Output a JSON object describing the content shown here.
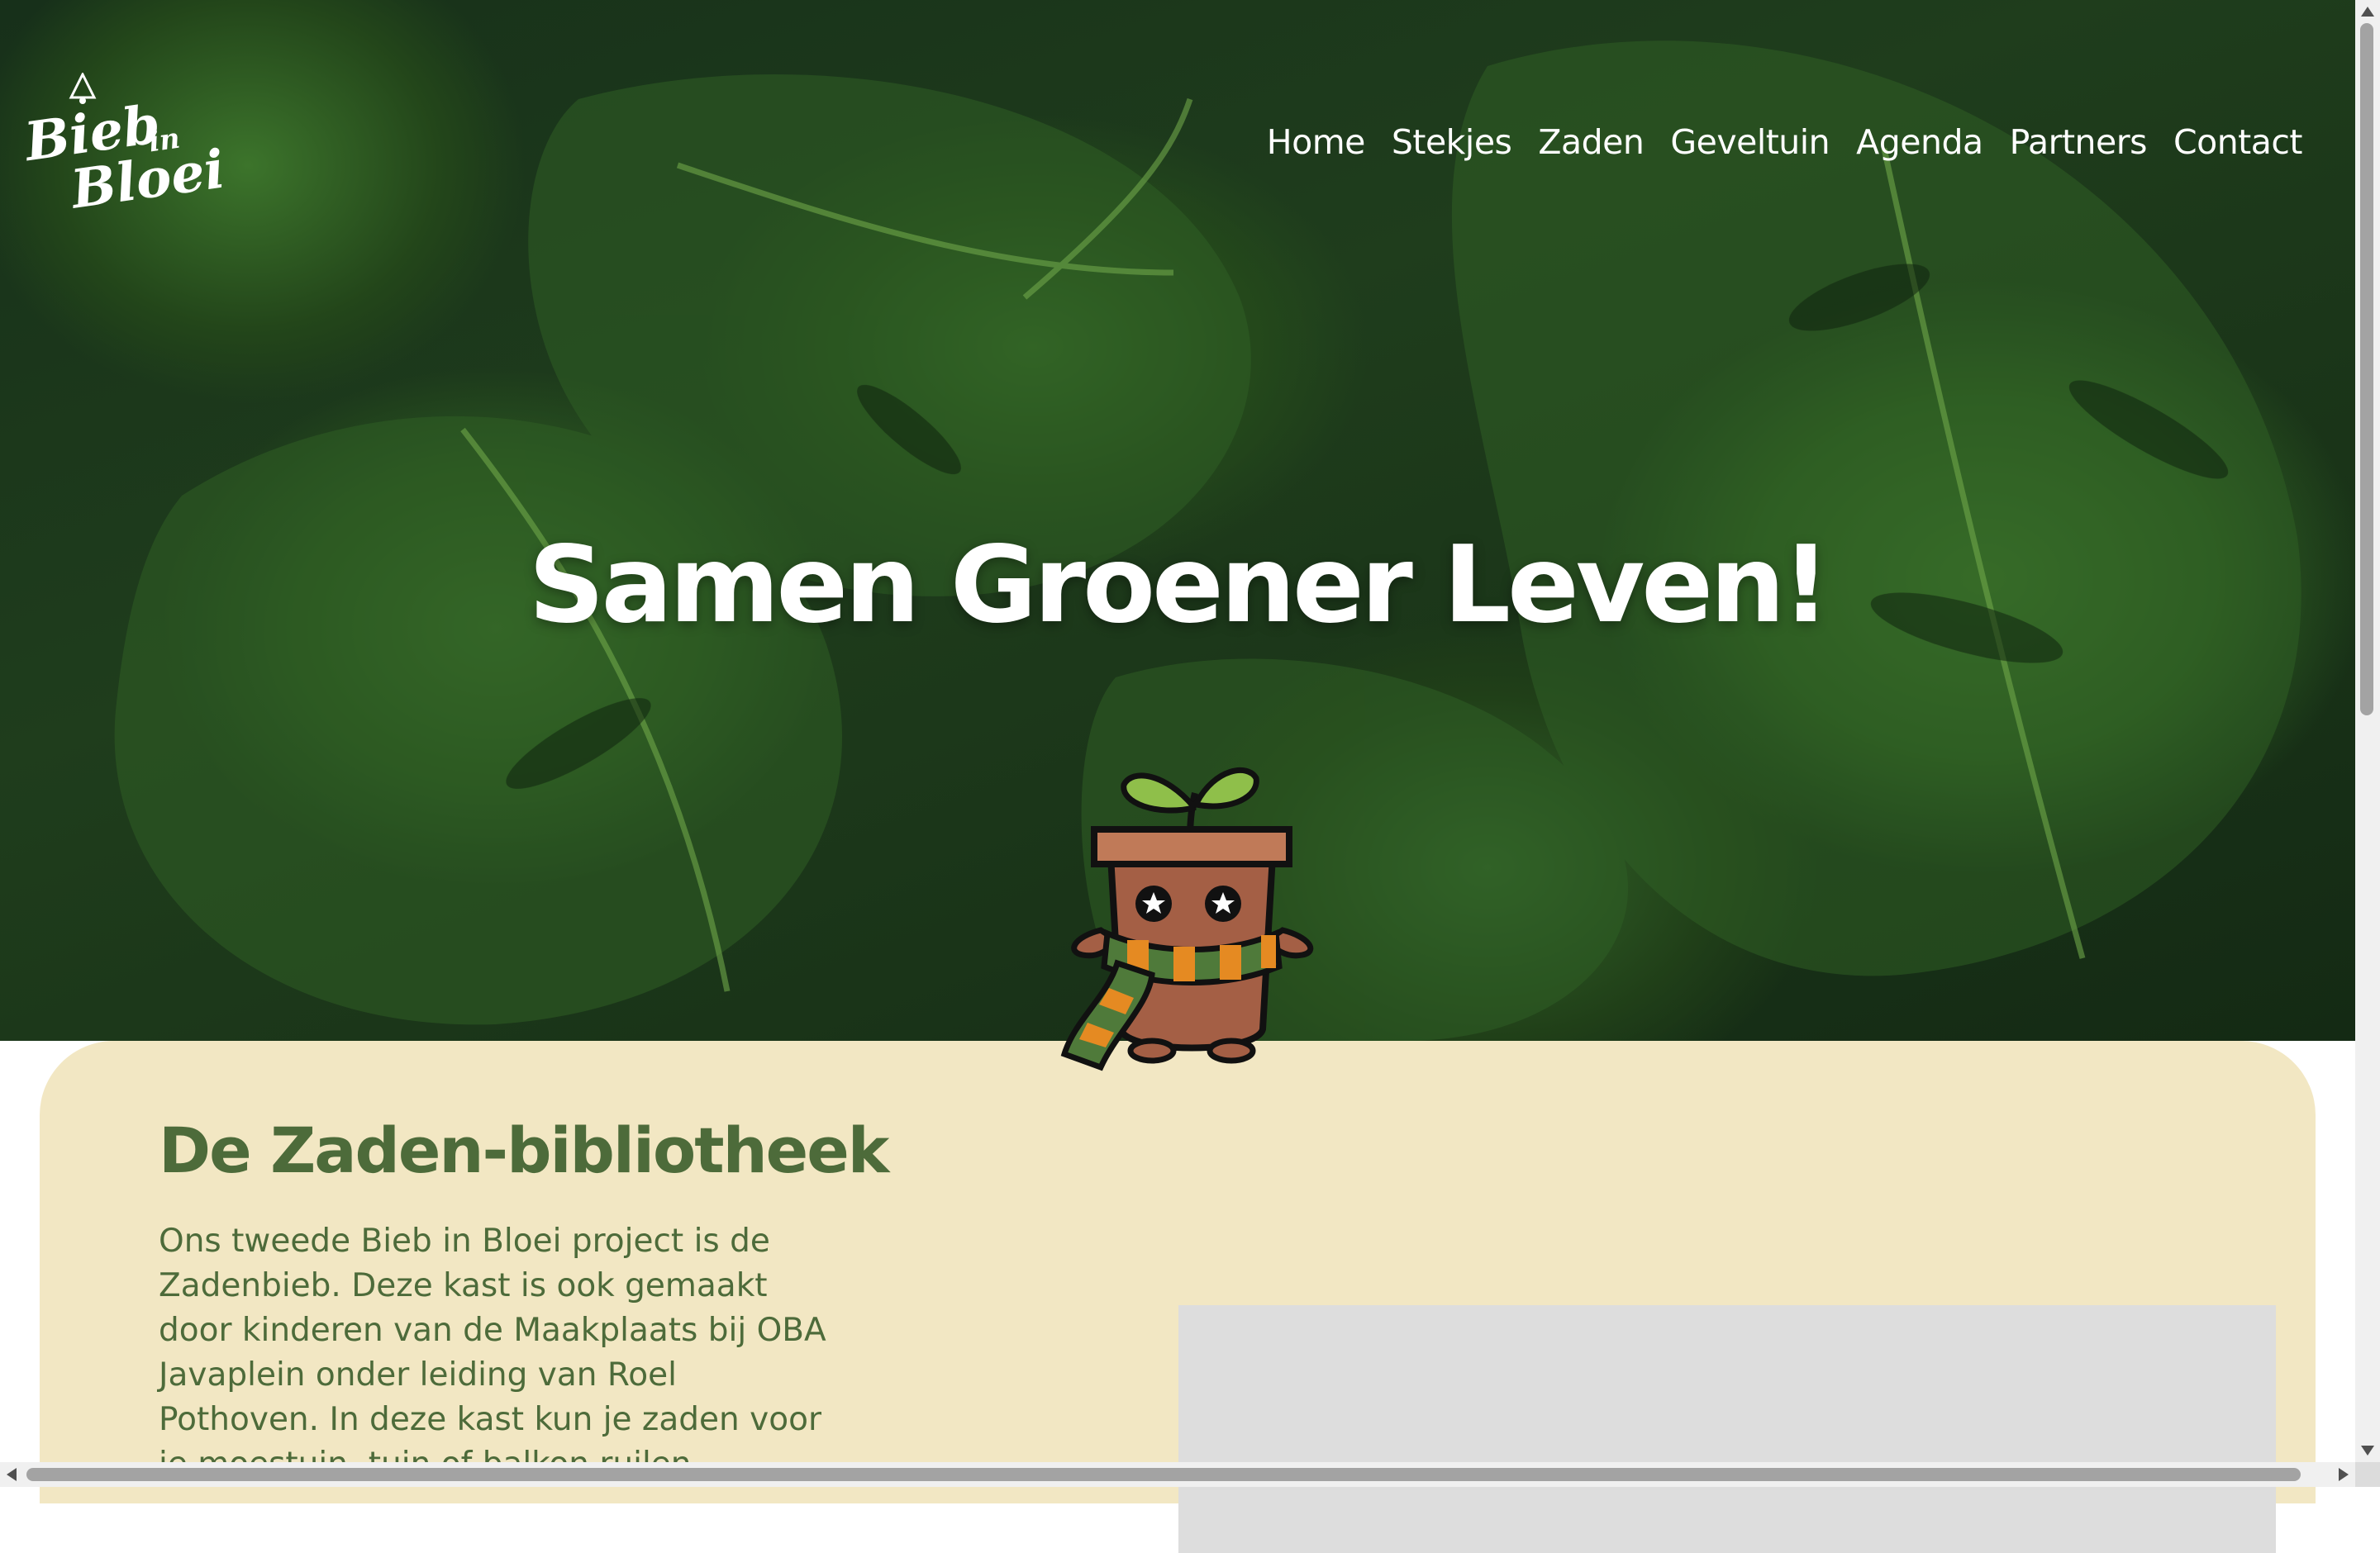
{
  "header": {
    "logo": {
      "line1": "Bieb",
      "line2": "in",
      "line3": "Bloei"
    },
    "nav": [
      "Home",
      "Stekjes",
      "Zaden",
      "Geveltuin",
      "Agenda",
      "Partners",
      "Contact"
    ]
  },
  "hero": {
    "title": "Samen Groener Leven!",
    "background": "monstera-leaves-photo",
    "mascot": "flowerpot-mascot-with-scarf"
  },
  "section": {
    "heading": "De Zaden-bibliotheek",
    "body": "Ons tweede Bieb in Bloei project is de Zadenbieb. Deze kast is ook gemaakt door kinderen van de Maakplaats bij OBA Javaplein onder leiding van Roel Pothoven. In deze kast kun je zaden voor je moestuin, tuin of balkon ruilen."
  },
  "colors": {
    "heading_green": "#4d6b3a",
    "card_cream": "#f2e7c3",
    "placeholder_gray": "#dddddd"
  }
}
